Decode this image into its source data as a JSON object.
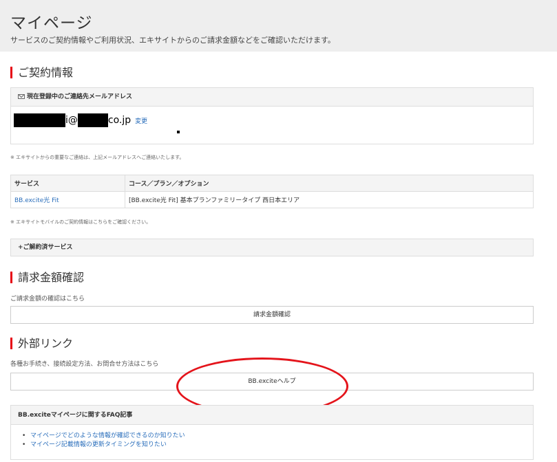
{
  "header": {
    "title": "マイページ",
    "subtitle": "サービスのご契約情報やご利用状況、エキサイトからのご請求金額などをご確認いただけます。"
  },
  "contract": {
    "section_title": "ご契約情報",
    "email_box_header": "現在登録中のご連絡先メールアドレス",
    "email_part1": "i@",
    "email_part2": "co.jp",
    "change_label": "変更",
    "email_note": "※ エキサイトからの重要なご連絡は、上記メールアドレスへご連絡いたします。",
    "table": {
      "headers": [
        "サービス",
        "コース／プラン／オプション"
      ],
      "rows": [
        {
          "service": "BB.excite光 Fit",
          "plan": "[BB.excite光 Fit] 基本プランファミリータイプ 西日本エリア"
        }
      ]
    },
    "mobile_note": "※ エキサイトモバイルのご契約情報はこちらをご確認ください。",
    "cancelled_label": "+ご解約済サービス"
  },
  "billing": {
    "section_title": "請求金額確認",
    "description": "ご請求金額の確認はこちら",
    "button_label": "請求金額確認"
  },
  "external": {
    "section_title": "外部リンク",
    "description": "各種お手続き、接続設定方法、お問合せ方法はこちら",
    "button_label": "BB.exciteヘルプ"
  },
  "faq": {
    "header": "BB.exciteマイページに関するFAQ記事",
    "items": [
      "マイページでどのような情報が確認できるのか知りたい",
      "マイページ記載情報の更新タイミングを知りたい"
    ]
  },
  "colors": {
    "accent_red": "#e60012",
    "link_blue": "#2a6ebb",
    "annotation_red": "#e4141b"
  }
}
